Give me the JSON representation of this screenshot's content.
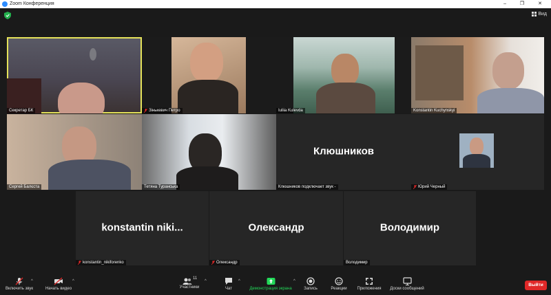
{
  "window": {
    "title": "Zoom Конференция",
    "controls": "– ❐ ✕"
  },
  "view_button": "Вид",
  "participants_tiles": [
    {
      "name": "Секретар БК",
      "muted": false,
      "video": true
    },
    {
      "name": "Зінькевич Петро",
      "muted": true,
      "video": true
    },
    {
      "name": "Iuliia Kulevda",
      "muted": false,
      "video": true
    },
    {
      "name": "Konstantin Kuchynskyi",
      "muted": false,
      "video": true
    },
    {
      "name": "Сергей Балєста",
      "muted": false,
      "video": true
    },
    {
      "name": "Тетяна Туранська",
      "muted": false,
      "video": true
    },
    {
      "name": "Клюшников подключает звук -",
      "big_name": "Клюшников",
      "muted": false,
      "video": false
    },
    {
      "name": "Юрий Черный",
      "muted": true,
      "video": false,
      "avatar": true
    },
    {
      "name": "konstantin_nikiforenko",
      "big_name": "konstantin   niki...",
      "muted": true,
      "video": false
    },
    {
      "name": "Олександр",
      "big_name": "Олександр",
      "muted": true,
      "video": false
    },
    {
      "name": "Володимир",
      "big_name": "Володимир",
      "muted": false,
      "video": false
    }
  ],
  "toolbar": {
    "unmute": "Включить звук",
    "start_video": "Начать видео",
    "participants": "Участники",
    "participants_count": "11",
    "chat": "Чат",
    "share_screen": "Демонстрация экрана",
    "record": "Запись",
    "reactions": "Реакции",
    "apps": "Приложения",
    "whiteboards": "Доски сообщений",
    "leave": "Выйти"
  },
  "colors": {
    "accent": "#2d8cff",
    "leave": "#e02828",
    "share": "#23d959",
    "active_speaker": "#e6e35a"
  }
}
